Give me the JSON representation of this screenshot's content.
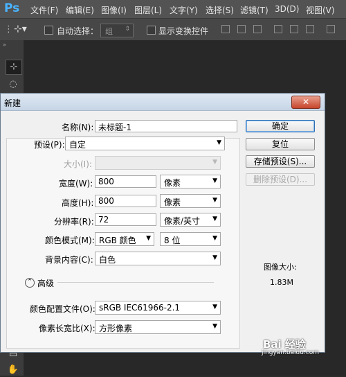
{
  "app": {
    "logo": "Ps"
  },
  "menu": [
    "文件(F)",
    "编辑(E)",
    "图像(I)",
    "图层(L)",
    "文字(Y)",
    "选择(S)",
    "滤镜(T)",
    "3D(D)",
    "视图(V)"
  ],
  "options_bar": {
    "auto_select_label": "自动选择：",
    "auto_select_value": "组",
    "show_transform_label": "显示变换控件"
  },
  "dialog": {
    "title": "新建",
    "close": "✕",
    "name_label": "名称(N):",
    "name_value": "未标题-1",
    "preset_label": "预设(P):",
    "preset_value": "自定",
    "size_label": "大小(I):",
    "size_value": "",
    "width_label": "宽度(W):",
    "width_value": "800",
    "width_unit": "像素",
    "height_label": "高度(H):",
    "height_value": "800",
    "height_unit": "像素",
    "resolution_label": "分辨率(R):",
    "resolution_value": "72",
    "resolution_unit": "像素/英寸",
    "color_mode_label": "颜色模式(M):",
    "color_mode_value": "RGB 颜色",
    "bit_depth_value": "8 位",
    "background_label": "背景内容(C):",
    "background_value": "白色",
    "advanced_label": "高级",
    "color_profile_label": "颜色配置文件(O):",
    "color_profile_value": "sRGB IEC61966-2.1",
    "pixel_aspect_label": "像素长宽比(X):",
    "pixel_aspect_value": "方形像素",
    "buttons": {
      "ok": "确定",
      "reset": "复位",
      "save_preset": "存储预设(S)...",
      "delete_preset": "删除预设(D)..."
    },
    "image_size_label": "图像大小:",
    "image_size_value": "1.83M"
  },
  "watermark": {
    "text": "Bai 经验",
    "url": "jingyan.baidu.com"
  }
}
